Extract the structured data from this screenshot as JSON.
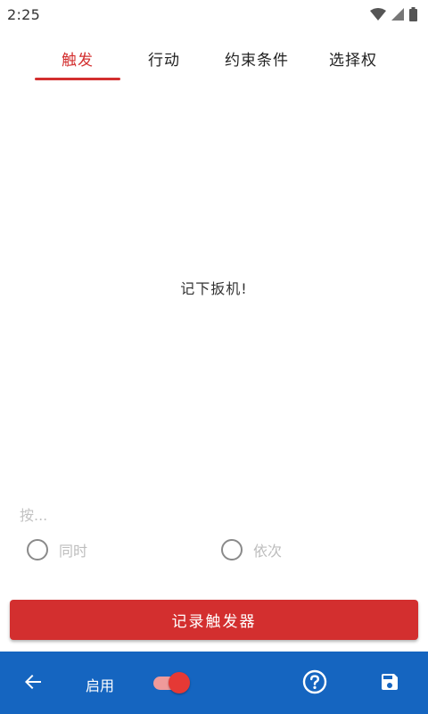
{
  "status_bar": {
    "time": "2:25"
  },
  "tabs": [
    {
      "label": "触发",
      "active": true
    },
    {
      "label": "行动",
      "active": false
    },
    {
      "label": "约束条件",
      "active": false
    },
    {
      "label": "选择权",
      "active": false
    }
  ],
  "main": {
    "empty_message": "记下扳机!"
  },
  "trigger_mode": {
    "label": "按...",
    "options": [
      {
        "label": "同时",
        "selected": false
      },
      {
        "label": "依次",
        "selected": false
      }
    ]
  },
  "record_button": {
    "label": "记录触发器"
  },
  "bottom_bar": {
    "enable_label": "启用",
    "enabled": true,
    "back_icon": "arrow-back-icon",
    "help_icon": "help-circle-icon",
    "save_icon": "save-icon"
  },
  "colors": {
    "accent": "#d32f2f",
    "bottom_bar": "#1565c0",
    "toggle_thumb": "#e53935",
    "toggle_track": "#ef9a9a"
  }
}
